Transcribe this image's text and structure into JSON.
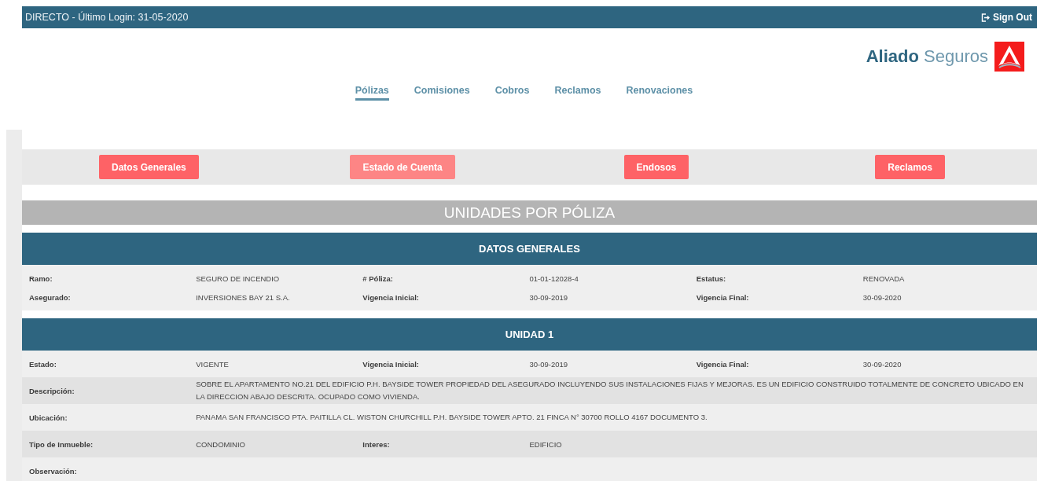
{
  "top_bar": {
    "login_text": "DIRECTO - Último Login: 31-05-2020",
    "sign_out": "Sign Out"
  },
  "logo": {
    "bold": "Aliado",
    "light": "Seguros"
  },
  "nav": [
    {
      "label": "Pólizas",
      "selected": true
    },
    {
      "label": "Comisiones",
      "selected": false
    },
    {
      "label": "Cobros",
      "selected": false
    },
    {
      "label": "Reclamos",
      "selected": false
    },
    {
      "label": "Renovaciones",
      "selected": false
    }
  ],
  "actions": [
    {
      "label": "Datos Generales",
      "dimmed": false
    },
    {
      "label": "Estado de Cuenta",
      "dimmed": true
    },
    {
      "label": "Endosos",
      "dimmed": false
    },
    {
      "label": "Reclamos",
      "dimmed": false
    }
  ],
  "page_title": "UNIDADES POR PÓLIZA",
  "sections": [
    {
      "title": "DATOS GENERALES",
      "striped": false,
      "rows": [
        {
          "cells": [
            {
              "label": "Ramo:",
              "value": "SEGURO DE INCENDIO"
            },
            {
              "label": "# Póliza:",
              "value": "01-01-12028-4"
            },
            {
              "label": "Estatus:",
              "value": "RENOVADA"
            }
          ]
        },
        {
          "cells": [
            {
              "label": "Asegurado:",
              "value": "INVERSIONES BAY 21 S.A."
            },
            {
              "label": "Vigencia Inicial:",
              "value": "30-09-2019"
            },
            {
              "label": "Vigencia Final:",
              "value": "30-09-2020"
            }
          ]
        }
      ]
    },
    {
      "title": "UNIDAD 1",
      "striped": true,
      "rows": [
        {
          "cells": [
            {
              "label": "Estado:",
              "value": "VIGENTE"
            },
            {
              "label": "Vigencia Inicial:",
              "value": "30-09-2019"
            },
            {
              "label": "Vigencia Final:",
              "value": "30-09-2020"
            }
          ]
        },
        {
          "cells": [
            {
              "label": "Descripción:",
              "value": "SOBRE EL APARTAMENTO NO.21 DEL EDIFICIO P.H. BAYSIDE TOWER PROPIEDAD DEL ASEGURADO INCLUYENDO SUS INSTALACIONES FIJAS Y MEJORAS. ES UN EDIFICIO CONSTRUIDO TOTALMENTE DE CONCRETO UBICADO EN LA DIRECCION ABAJO DESCRITA. OCUPADO COMO VIVIENDA."
            }
          ]
        },
        {
          "cells": [
            {
              "label": "Ubicación:",
              "value": "PANAMA SAN FRANCISCO PTA. PAITILLA CL. WISTON CHURCHILL P.H. BAYSIDE TOWER APTO. 21 FINCA N° 30700 ROLLO 4167 DOCUMENTO 3."
            }
          ]
        },
        {
          "cells": [
            {
              "label": "Tipo de Inmueble:",
              "value": "CONDOMINIO"
            },
            {
              "label": "Interes:",
              "value": "EDIFICIO"
            }
          ]
        },
        {
          "cells": [
            {
              "label": "Observación:"
            }
          ]
        }
      ]
    }
  ]
}
